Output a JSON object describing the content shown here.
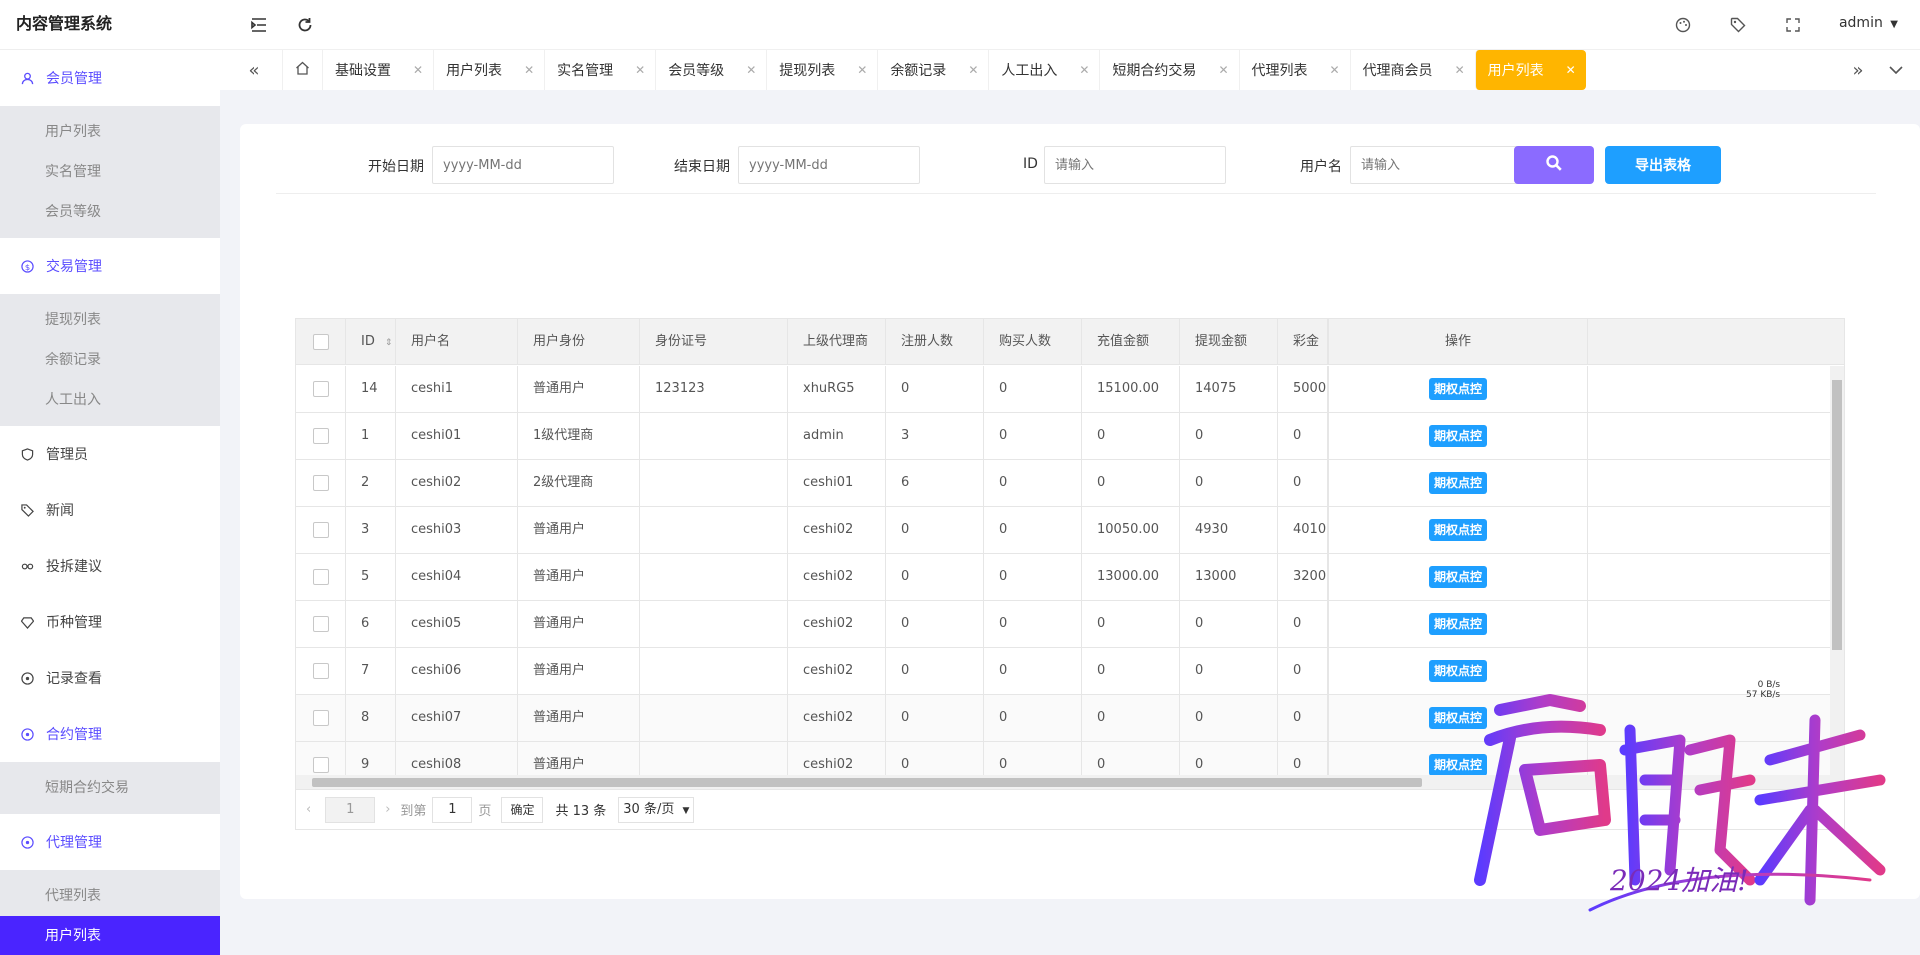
{
  "app": {
    "title": "内容管理系统"
  },
  "topbar": {
    "user": "admin"
  },
  "sidebar": {
    "groups": [
      {
        "label": "会员管理",
        "icon": "user-icon",
        "active": true,
        "items": [
          {
            "label": "用户列表"
          },
          {
            "label": "实名管理"
          },
          {
            "label": "会员等级"
          }
        ]
      },
      {
        "label": "交易管理",
        "icon": "dollar-icon",
        "active": true,
        "items": [
          {
            "label": "提现列表"
          },
          {
            "label": "余额记录"
          },
          {
            "label": "人工出入"
          }
        ]
      },
      {
        "label": "管理员",
        "icon": "shield-icon"
      },
      {
        "label": "新闻",
        "icon": "tag-icon"
      },
      {
        "label": "投拆建议",
        "icon": "link-icon"
      },
      {
        "label": "币种管理",
        "icon": "diamond-icon"
      },
      {
        "label": "记录查看",
        "icon": "target-icon"
      },
      {
        "label": "合约管理",
        "icon": "target-icon",
        "active": true,
        "items": [
          {
            "label": "短期合约交易"
          }
        ]
      },
      {
        "label": "代理管理",
        "icon": "target-icon",
        "active": true,
        "items": [
          {
            "label": "代理列表"
          },
          {
            "label": "用户列表"
          }
        ]
      }
    ]
  },
  "tabs": [
    {
      "label": "基础设置"
    },
    {
      "label": "用户列表"
    },
    {
      "label": "实名管理"
    },
    {
      "label": "会员等级"
    },
    {
      "label": "提现列表"
    },
    {
      "label": "余额记录"
    },
    {
      "label": "人工出入"
    },
    {
      "label": "短期合约交易"
    },
    {
      "label": "代理列表"
    },
    {
      "label": "代理商会员"
    },
    {
      "label": "用户列表",
      "active": true
    }
  ],
  "filters": {
    "start_label": "开始日期",
    "start_placeholder": "yyyy-MM-dd",
    "end_label": "结束日期",
    "end_placeholder": "yyyy-MM-dd",
    "id_label": "ID",
    "id_placeholder": "请输入",
    "username_label": "用户名",
    "username_placeholder": "请输入",
    "export_label": "导出表格"
  },
  "table": {
    "columns": [
      "ID",
      "用户名",
      "用户身份",
      "身份证号",
      "上级代理商",
      "注册人数",
      "购买人数",
      "充值金额",
      "提现金额",
      "彩金",
      "操作"
    ],
    "action_label": "期权点控",
    "rows": [
      [
        "14",
        "ceshi1",
        "普通用户",
        "123123",
        "xhuRG5",
        "0",
        "0",
        "15100.00",
        "14075",
        "5000.00"
      ],
      [
        "1",
        "ceshi01",
        "1级代理商",
        "",
        "admin",
        "3",
        "0",
        "0",
        "0",
        "0"
      ],
      [
        "2",
        "ceshi02",
        "2级代理商",
        "",
        "ceshi01",
        "6",
        "0",
        "0",
        "0",
        "0"
      ],
      [
        "3",
        "ceshi03",
        "普通用户",
        "",
        "ceshi02",
        "0",
        "0",
        "10050.00",
        "4930",
        "4010.00"
      ],
      [
        "5",
        "ceshi04",
        "普通用户",
        "",
        "ceshi02",
        "0",
        "0",
        "13000.00",
        "13000",
        "3200.00"
      ],
      [
        "6",
        "ceshi05",
        "普通用户",
        "",
        "ceshi02",
        "0",
        "0",
        "0",
        "0",
        "0"
      ],
      [
        "7",
        "ceshi06",
        "普通用户",
        "",
        "ceshi02",
        "0",
        "0",
        "0",
        "0",
        "0"
      ],
      [
        "8",
        "ceshi07",
        "普通用户",
        "",
        "ceshi02",
        "0",
        "0",
        "0",
        "0",
        "0"
      ],
      [
        "9",
        "ceshi08",
        "普通用户",
        "",
        "ceshi02",
        "0",
        "0",
        "0",
        "0",
        "0"
      ]
    ]
  },
  "pager": {
    "current": "1",
    "goto_label": "到第",
    "goto_value": "1",
    "page_unit": "页",
    "confirm": "确定",
    "total": "共 13 条",
    "page_size": "30 条/页"
  },
  "overlay": {
    "watermark_text": "启航未来",
    "watermark_sub": "2024加油!",
    "net_up": "0 B/s",
    "net_down": "57 KB/s"
  },
  "colors": {
    "accent": "#4a24ff",
    "active_tab": "#ffb500",
    "button_blue": "#1e9fff",
    "search_purple": "#8b6bff"
  }
}
